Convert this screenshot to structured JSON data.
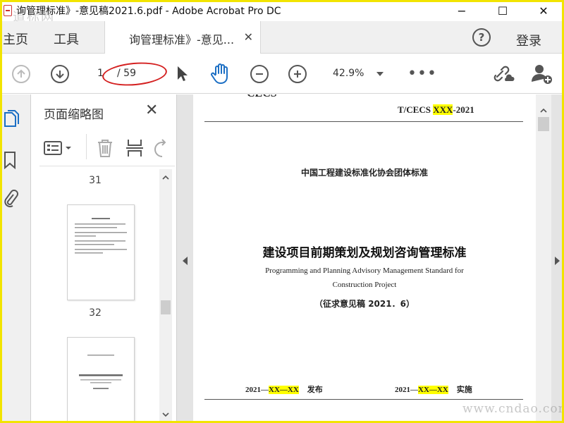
{
  "window": {
    "title": "询管理标准》-意见稿2021.6.pdf - Adobe Acrobat Pro DC",
    "watermark_tl": "道标网",
    "controls": {
      "minimize": "−",
      "maximize": "☐",
      "close": "✕"
    }
  },
  "tabs": {
    "home": "主页",
    "tools": "工具",
    "document": "询管理标准》-意见...",
    "document_close": "✕",
    "help": "?",
    "login": "登录"
  },
  "toolbar": {
    "current_page": "1",
    "total_pages": "/ 59",
    "zoom": "42.9%",
    "more": "•••",
    "annotation_color": "#d42020"
  },
  "thumbnail_panel": {
    "title": "页面缩略图",
    "close": "✕",
    "pages": [
      {
        "label": "31"
      },
      {
        "label": "32"
      }
    ]
  },
  "document": {
    "cecs_heading": "CECS",
    "code_prefix": "T/CECS ",
    "code_highlight": "XXX",
    "code_suffix": "-2021",
    "association": "中国工程建设标准化协会团体标准",
    "title": "建设项目前期策划及规划咨询管理标准",
    "title_en_line1": "Programming and Planning Advisory Management Standard for",
    "title_en_line2": "Construction Project",
    "draft_note": "（征求意见稿 2021．6）",
    "issue_date_prefix": "2021—",
    "issue_date_highlight": "XX—XX",
    "issue_label": "发布",
    "impl_date_prefix": "2021—",
    "impl_date_highlight": "XX—XX",
    "impl_label": "实施",
    "highlight_color": "#ffff00"
  },
  "watermark_br": "www.cndao.com",
  "frame_color": "#f2e400"
}
